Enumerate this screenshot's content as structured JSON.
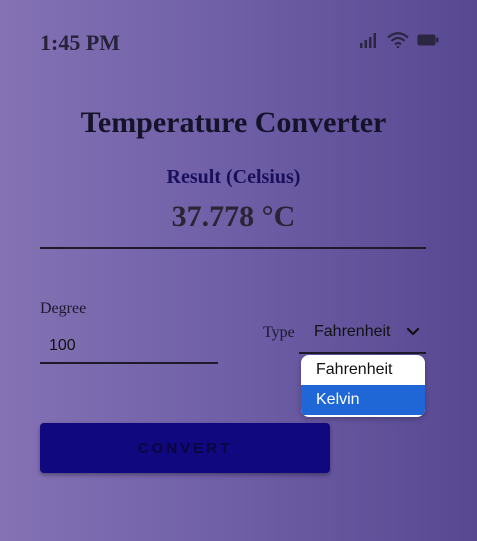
{
  "status_bar": {
    "time": "1:45 PM",
    "icons": [
      "signal-icon",
      "wifi-icon",
      "battery-icon"
    ]
  },
  "title": "Temperature Converter",
  "result": {
    "label": "Result (Celsius)",
    "value": "37.778 °C"
  },
  "degree": {
    "label": "Degree",
    "value": "100"
  },
  "type": {
    "label": "Type",
    "selected": "Fahrenheit",
    "options": [
      "Fahrenheit",
      "Kelvin"
    ],
    "highlighted_option": "Kelvin"
  },
  "convert_button": {
    "label": "CONVERT"
  },
  "colors": {
    "accent": "#10087e",
    "highlight": "#1f67d6",
    "result_label": "#1a0f5c"
  }
}
